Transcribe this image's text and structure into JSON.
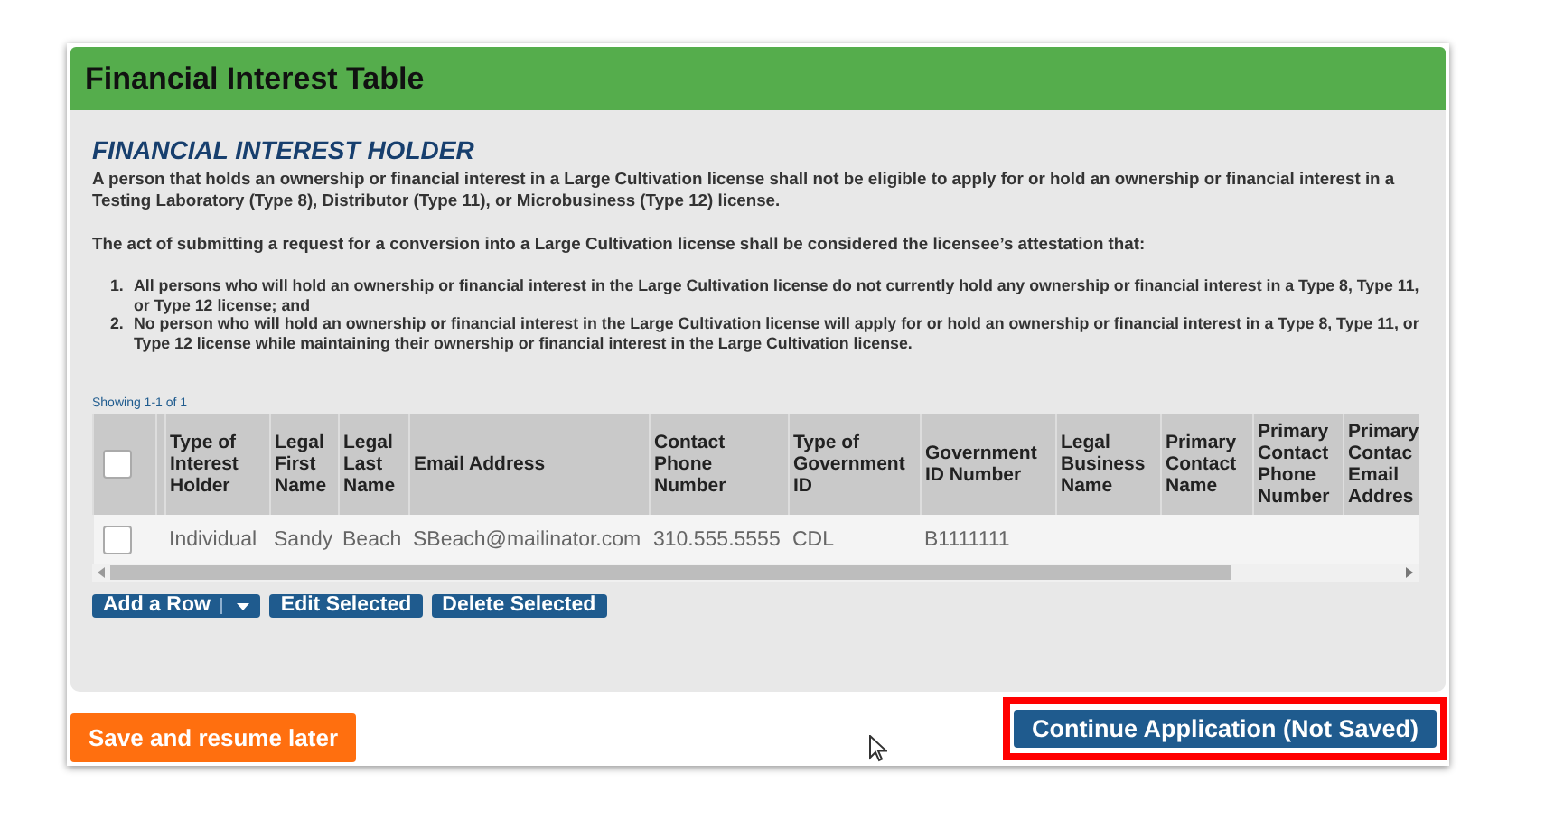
{
  "panel": {
    "title": "Financial Interest Table"
  },
  "section": {
    "heading": "FINANCIAL INTEREST HOLDER",
    "paragraphs": [
      "A person that holds an ownership or financial interest in a Large Cultivation license shall not be eligible to apply for or hold an ownership or financial interest in a Testing Laboratory (Type 8), Distributor (Type 11), or Microbusiness (Type 12) license.",
      "The act of submitting a request for a conversion into a Large Cultivation license shall be considered the licensee’s attestation that:"
    ],
    "list": [
      {
        "number": "1.",
        "text": "All persons who will hold an ownership or financial interest in the Large Cultivation license do not currently hold any ownership or financial interest in a Type 8, Type 11, or Type 12 license; and"
      },
      {
        "number": "2.",
        "text": "No person who will hold an ownership or financial interest in the Large Cultivation license will apply for or hold an ownership or financial interest in a Type 8, Type 11, or Type 12 license while maintaining their ownership or financial interest in the Large Cultivation license."
      }
    ]
  },
  "table": {
    "showing": "Showing 1-1 of 1",
    "select_all": {
      "checked": false
    },
    "columns": [
      "Type of Interest Holder",
      "Legal First Name",
      "Legal Last Name",
      "Email Address",
      "Contact Phone Number",
      "Type of Government ID",
      "Government ID Number",
      "Legal Business Name",
      "Primary Contact Name",
      "Primary Contact Phone Number",
      "Primary Contac Email Addres"
    ],
    "rows": [
      {
        "checked": false,
        "cells": [
          "Individual",
          "Sandy",
          "Beach",
          "SBeach@mailinator.com",
          "310.555.5555",
          "CDL",
          "B1111111"
        ]
      }
    ],
    "actions": {
      "add": "Add a Row",
      "edit": "Edit Selected",
      "delete": "Delete Selected"
    }
  },
  "footer": {
    "save": "Save and resume later",
    "continue": {
      "label": "Continue Application (Not Saved)",
      "highlighted": true
    }
  }
}
